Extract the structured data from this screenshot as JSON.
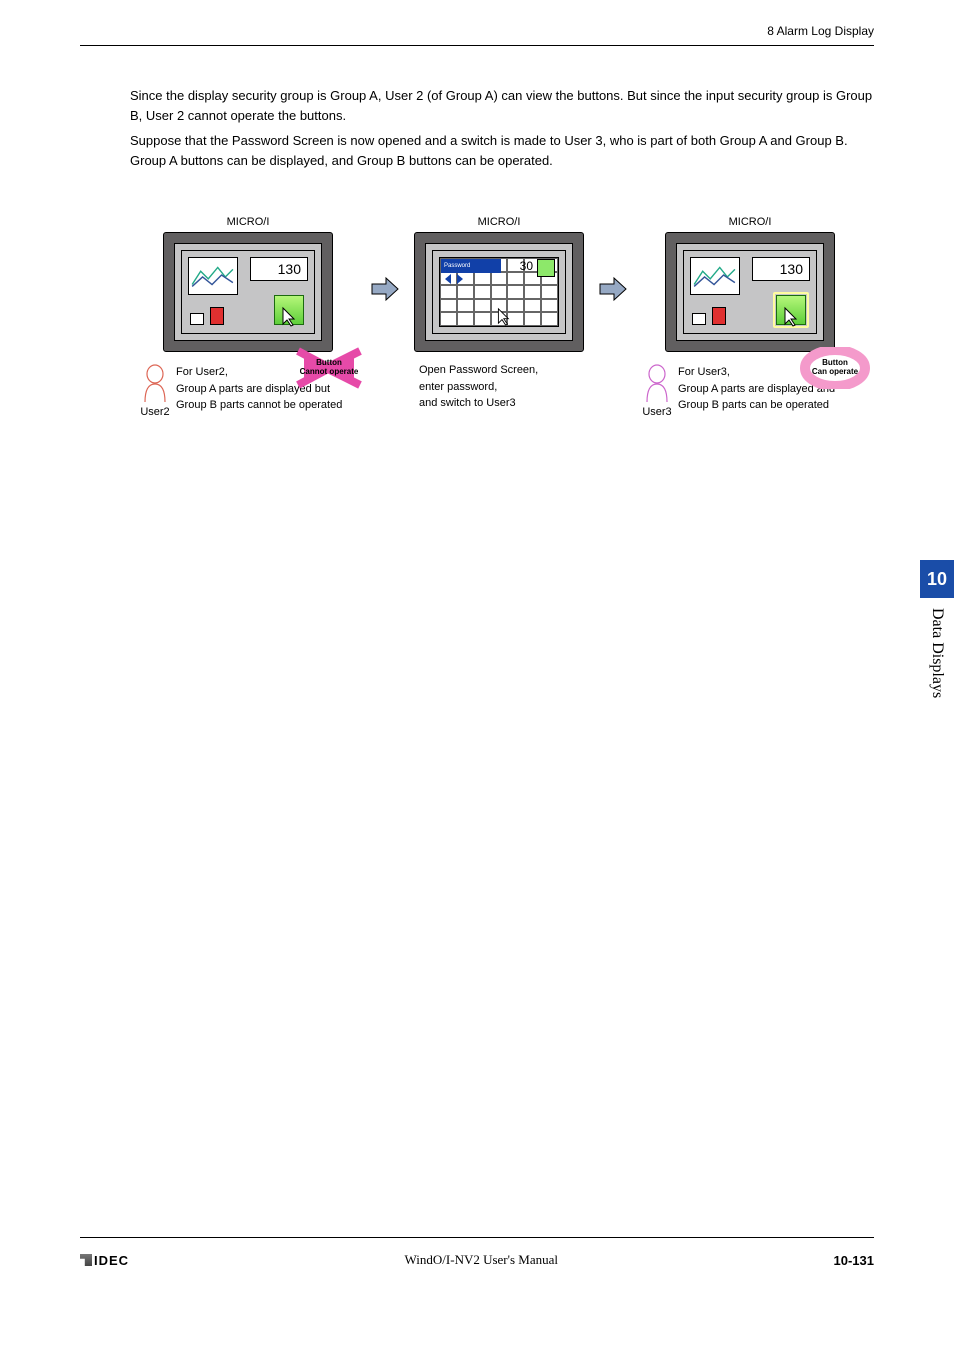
{
  "header": {
    "section": "8 Alarm Log Display"
  },
  "body": {
    "p1": "Since the display security group is Group A, User 2 (of Group A) can view the buttons. But since the input security group is Group B, User 2 cannot operate the buttons.",
    "p2": "Suppose that the Password Screen is now opened and a switch is made to User 3, who is part of both Group A and Group B. Group A buttons can be displayed, and Group B buttons can be operated."
  },
  "diagram": {
    "micro_label": "MICRO/I",
    "value": "130",
    "value_pw": "30",
    "pw_title": "Password",
    "badge_cannot": {
      "line1": "Button",
      "line2": "Cannot operate"
    },
    "badge_can": {
      "line1": "Button",
      "line2": "Can operate"
    },
    "user2": {
      "label": "User2",
      "line1": "For User2,",
      "line2": "Group A parts are displayed but",
      "line3": "Group B parts cannot be operated"
    },
    "middle": {
      "line1": "Open Password Screen,",
      "line2": "enter password,",
      "line3": "and switch to User3"
    },
    "user3": {
      "label": "User3",
      "line1": "For User3,",
      "line2": "Group A parts are displayed and",
      "line3": "Group B parts can be operated"
    }
  },
  "sidetab": {
    "num": "10",
    "label": "Data Displays"
  },
  "footer": {
    "logo": "IDEC",
    "center": "WindO/I-NV2 User's Manual",
    "page": "10-131"
  }
}
